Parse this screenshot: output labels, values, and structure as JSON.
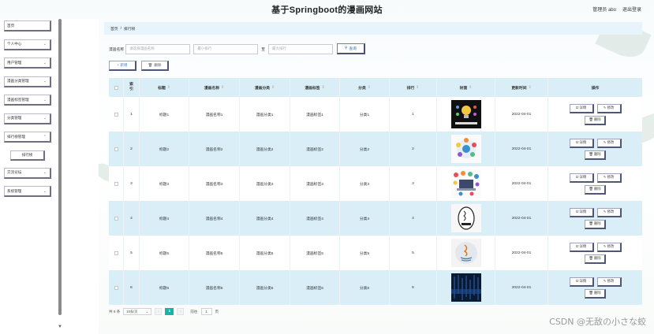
{
  "header": {
    "site_title": "基于Springboot的漫画网站",
    "user_label": "管理员 abo",
    "logout_label": "退出登录"
  },
  "sidebar": {
    "items": [
      {
        "label": "首页",
        "has_children": false
      },
      {
        "label": "个人中心",
        "has_children": true
      },
      {
        "label": "用户管理",
        "has_children": true
      },
      {
        "label": "漫画分类管理",
        "has_children": true
      },
      {
        "label": "漫画标签管理",
        "has_children": true
      },
      {
        "label": "分类管理",
        "has_children": true
      },
      {
        "label": "排行榜管理",
        "has_children": true,
        "expanded": true,
        "sub": [
          "排行榜"
        ]
      },
      {
        "label": "交流论坛",
        "has_children": true
      },
      {
        "label": "系统管理",
        "has_children": true
      }
    ]
  },
  "breadcrumb": {
    "home": "首页",
    "separator": "/",
    "current": "排行榜"
  },
  "filters": {
    "name_label": "漫画名称",
    "name_placeholder": "请选择漫画名称",
    "min_rank_placeholder": "最小排行",
    "to_label": "至",
    "max_rank_placeholder": "最大排行",
    "search_label": "查询"
  },
  "actions": {
    "add_label": "+ 新增",
    "delete_label": "删除"
  },
  "table": {
    "headers": {
      "index": "索引",
      "title": "标题",
      "name": "漫画名称",
      "category": "漫画分类",
      "tag": "漫画标签",
      "fen": "分类",
      "rank": "排行",
      "cover": "封面",
      "date": "更新时间",
      "ops": "操作"
    },
    "rows": [
      {
        "index": "1",
        "title": "标题1",
        "name": "漫画名称1",
        "category": "漫画分类1",
        "tag": "漫画标签1",
        "fen": "分类1",
        "rank": "1",
        "date": "2022-04-01",
        "cover": "cover-revolution"
      },
      {
        "index": "2",
        "title": "标题2",
        "name": "漫画名称2",
        "category": "漫画分类2",
        "tag": "漫画标签2",
        "fen": "分类2",
        "rank": "2",
        "date": "2022-04-01",
        "cover": "cover-circle-infographic"
      },
      {
        "index": "3",
        "title": "标题3",
        "name": "漫画名称3",
        "category": "漫画分类3",
        "tag": "漫画标签3",
        "fen": "分类3",
        "rank": "3",
        "date": "2022-04-01",
        "cover": "cover-laptop-icons"
      },
      {
        "index": "4",
        "title": "标题4",
        "name": "漫画名称4",
        "category": "漫画分类4",
        "tag": "漫画标签4",
        "fen": "分类4",
        "rank": "4",
        "date": "2022-04-01",
        "cover": "cover-java-badge"
      },
      {
        "index": "5",
        "title": "标题5",
        "name": "漫画名称5",
        "category": "漫画分类5",
        "tag": "漫画标签5",
        "fen": "分类5",
        "rank": "5",
        "date": "2022-04-01",
        "cover": "cover-java-logo"
      },
      {
        "index": "6",
        "title": "标题6",
        "name": "漫画名称6",
        "category": "漫画分类6",
        "tag": "漫画标签6",
        "fen": "分类6",
        "rank": "6",
        "date": "2022-04-01",
        "cover": "cover-digital-code"
      }
    ],
    "op_detail": "详情",
    "op_edit": "修改",
    "op_delete": "删除"
  },
  "pagination": {
    "total_label": "共 6 条",
    "page_size": "10条/页",
    "current_page": "1",
    "goto_label": "前往",
    "goto_value": "1",
    "page_suffix": "页"
  },
  "watermark": "CSDN @无敌の小さな蛟",
  "colors": {
    "accent_teal": "#17b3a5",
    "header_row_blue": "#d9eef7",
    "breadcrumb_blue": "#e8f4fb",
    "link_blue": "#2c6fb5"
  }
}
